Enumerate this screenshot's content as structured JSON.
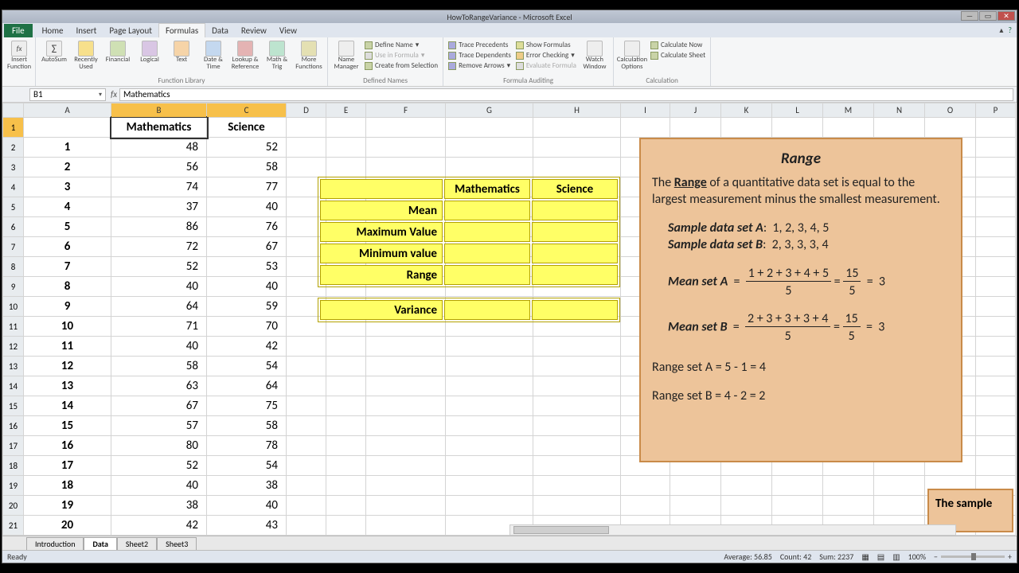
{
  "window": {
    "title": "HowToRangeVariance - Microsoft Excel"
  },
  "ribbon_tabs": [
    "Home",
    "Insert",
    "Page Layout",
    "Formulas",
    "Data",
    "Review",
    "View"
  ],
  "file_tab": "File",
  "ribbon_groups": {
    "insert_function": "Insert Function",
    "autosum": "AutoSum",
    "recently": "Recently Used",
    "financial": "Financial",
    "logical": "Logical",
    "text": "Text",
    "date": "Date & Time",
    "lookup": "Lookup & Reference",
    "math": "Math & Trig",
    "more": "More Functions",
    "name_mgr": "Name Manager",
    "define": "Define Name",
    "use_formula": "Use in Formula",
    "create_sel": "Create from Selection",
    "trace_prec": "Trace Precedents",
    "trace_dep": "Trace Dependents",
    "remove_arr": "Remove Arrows",
    "show_form": "Show Formulas",
    "err_check": "Error Checking",
    "eval": "Evaluate Formula",
    "watch": "Watch Window",
    "calc_opt": "Calculation Options",
    "calc_now": "Calculate Now",
    "calc_sheet": "Calculate Sheet",
    "g_lib": "Function Library",
    "g_names": "Defined Names",
    "g_audit": "Formula Auditing",
    "g_calc": "Calculation"
  },
  "namebox": "B1",
  "formula": "Mathematics",
  "columns": [
    "A",
    "B",
    "C",
    "D",
    "E",
    "F",
    "G",
    "H",
    "I",
    "J",
    "K",
    "L",
    "M",
    "N",
    "O",
    "P"
  ],
  "headers": {
    "math": "Mathematics",
    "sci": "Science"
  },
  "data": [
    {
      "i": 1,
      "m": 48,
      "s": 52
    },
    {
      "i": 2,
      "m": 56,
      "s": 58
    },
    {
      "i": 3,
      "m": 74,
      "s": 77
    },
    {
      "i": 4,
      "m": 37,
      "s": 40
    },
    {
      "i": 5,
      "m": 86,
      "s": 76
    },
    {
      "i": 6,
      "m": 72,
      "s": 67
    },
    {
      "i": 7,
      "m": 52,
      "s": 53
    },
    {
      "i": 8,
      "m": 40,
      "s": 40
    },
    {
      "i": 9,
      "m": 64,
      "s": 59
    },
    {
      "i": 10,
      "m": 71,
      "s": 70
    },
    {
      "i": 11,
      "m": 40,
      "s": 42
    },
    {
      "i": 12,
      "m": 58,
      "s": 54
    },
    {
      "i": 13,
      "m": 63,
      "s": 64
    },
    {
      "i": 14,
      "m": 67,
      "s": 75
    },
    {
      "i": 15,
      "m": 57,
      "s": 58
    },
    {
      "i": 16,
      "m": 80,
      "s": 78
    },
    {
      "i": 17,
      "m": 52,
      "s": 54
    },
    {
      "i": 18,
      "m": 40,
      "s": 38
    },
    {
      "i": 19,
      "m": 38,
      "s": 40
    },
    {
      "i": 20,
      "m": 42,
      "s": 43
    }
  ],
  "stats": {
    "col_math": "Mathematics",
    "col_sci": "Science",
    "rows": [
      "Mean",
      "Maximum Value",
      "Minimum value",
      "Range"
    ],
    "variance": "Variance"
  },
  "explain": {
    "title": "Range",
    "p1a": "The ",
    "p1b": "Range",
    "p1c": " of a quantitative data set is equal to the largest measurement minus the smallest measurement.",
    "setA_label": "Sample data set A",
    "setA": "1, 2, 3, 4, 5",
    "setB_label": "Sample data set B",
    "setB": "2, 3, 3, 3, 4",
    "meanA_label": "Mean set A",
    "meanA_num": "1 + 2 + 3 + 4 + 5",
    "meanA_den": "5",
    "meanA_r1n": "15",
    "meanA_r1d": "5",
    "meanA_res": "3",
    "meanB_label": "Mean set B",
    "meanB_num": "2 + 3 + 3 + 3 + 4",
    "meanB_den": "5",
    "meanB_r1n": "15",
    "meanB_r1d": "5",
    "meanB_res": "3",
    "rangeA": "Range set A  =  5 - 1  =  4",
    "rangeB": "Range set B  =  4 - 2  =  2"
  },
  "explain2": "The sample",
  "sheets": [
    "Introduction",
    "Data",
    "Sheet2",
    "Sheet3"
  ],
  "active_sheet": 1,
  "status": {
    "ready": "Ready",
    "average": "Average: 56.85",
    "count": "Count: 42",
    "sum": "Sum: 2237",
    "zoom": "100%"
  }
}
